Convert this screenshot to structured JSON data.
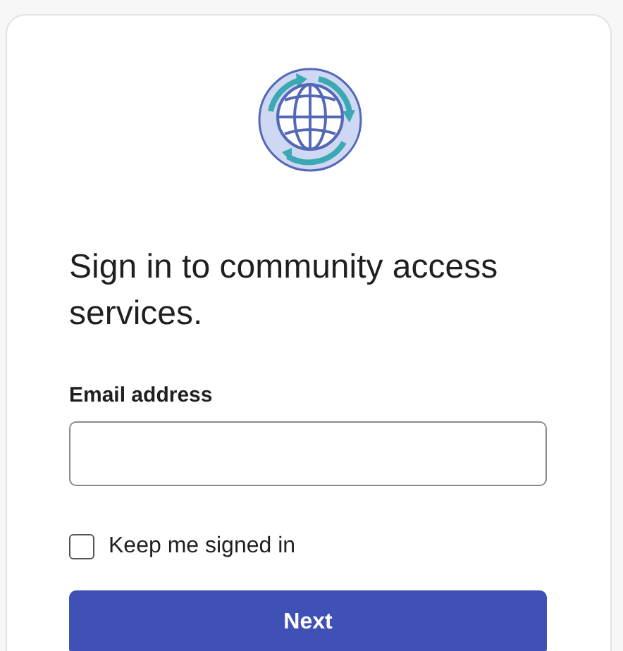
{
  "heading": "Sign in to community access services.",
  "email": {
    "label": "Email address"
  },
  "keep_signed_in": {
    "label": "Keep me signed in",
    "checked": false
  },
  "next_button": "Next"
}
